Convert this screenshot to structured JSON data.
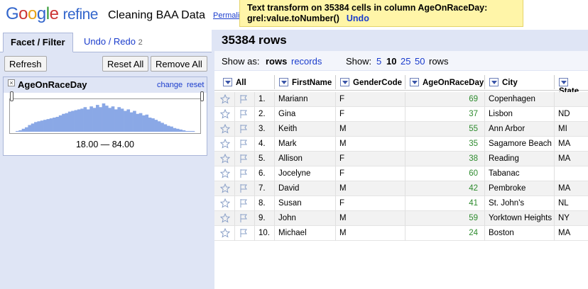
{
  "header": {
    "logo_google": "Google",
    "logo_refine": "refine",
    "project_name": "Cleaning BAA Data",
    "permalink": "Permali"
  },
  "notification": {
    "line1": "Text transform on 35384 cells in column AgeOnRaceDay:",
    "line2": "grel:value.toNumber()",
    "undo": "Undo"
  },
  "left": {
    "tabs": [
      {
        "label": "Facet / Filter"
      },
      {
        "label": "Undo / Redo",
        "count": "2"
      }
    ],
    "buttons": {
      "refresh": "Refresh",
      "reset_all": "Reset All",
      "remove_all": "Remove All"
    },
    "facet": {
      "close": "×",
      "title": "AgeOnRaceDay",
      "change": "change",
      "reset": "reset",
      "range": "18.00 — 84.00",
      "histogram": [
        1,
        2,
        4,
        6,
        9,
        11,
        13,
        14,
        15,
        16,
        17,
        18,
        19,
        20,
        22,
        24,
        25,
        27,
        28,
        29,
        30,
        31,
        33,
        30,
        34,
        32,
        36,
        33,
        38,
        35,
        32,
        34,
        30,
        33,
        31,
        28,
        30,
        26,
        28,
        24,
        25,
        22,
        23,
        19,
        18,
        16,
        14,
        12,
        10,
        8,
        7,
        5,
        4,
        3,
        2,
        1,
        1,
        1
      ]
    },
    "accent": "#dfe5f5"
  },
  "right": {
    "row_count": "35384 rows",
    "view": {
      "show_as": "Show as:",
      "rows": "rows",
      "records": "records",
      "show": "Show:",
      "sizes": [
        "5",
        "10",
        "25",
        "50"
      ],
      "selected_size": "10",
      "rows_suffix": "rows"
    },
    "columns": {
      "all": "All",
      "first": "FirstName",
      "gender": "GenderCode",
      "age": "AgeOnRaceDay",
      "city": "City",
      "state": "State"
    },
    "rows": [
      {
        "idx": "1.",
        "first": "Mariann",
        "gender": "F",
        "age": "69",
        "city": "Copenhagen",
        "state": ""
      },
      {
        "idx": "2.",
        "first": "Gina",
        "gender": "F",
        "age": "37",
        "city": "Lisbon",
        "state": "ND"
      },
      {
        "idx": "3.",
        "first": "Keith",
        "gender": "M",
        "age": "55",
        "city": "Ann Arbor",
        "state": "MI"
      },
      {
        "idx": "4.",
        "first": "Mark",
        "gender": "M",
        "age": "35",
        "city": "Sagamore Beach",
        "state": "MA"
      },
      {
        "idx": "5.",
        "first": "Allison",
        "gender": "F",
        "age": "38",
        "city": "Reading",
        "state": "MA"
      },
      {
        "idx": "6.",
        "first": "Jocelyne",
        "gender": "F",
        "age": "60",
        "city": "Tabanac",
        "state": ""
      },
      {
        "idx": "7.",
        "first": "David",
        "gender": "M",
        "age": "42",
        "city": "Pembroke",
        "state": "MA"
      },
      {
        "idx": "8.",
        "first": "Susan",
        "gender": "F",
        "age": "41",
        "city": "St. John's",
        "state": "NL"
      },
      {
        "idx": "9.",
        "first": "John",
        "gender": "M",
        "age": "59",
        "city": "Yorktown Heights",
        "state": "NY"
      },
      {
        "idx": "10.",
        "first": "Michael",
        "gender": "M",
        "age": "24",
        "city": "Boston",
        "state": "MA"
      }
    ],
    "numeric_color": "#2e8b2e"
  }
}
